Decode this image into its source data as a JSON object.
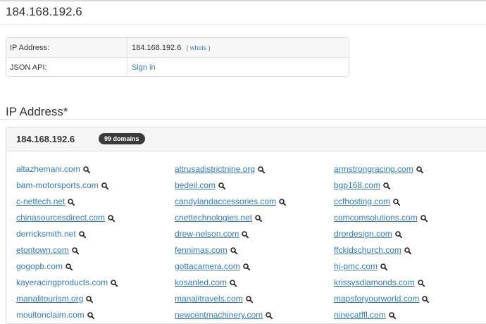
{
  "page": {
    "title": "184.168.192.6"
  },
  "info": {
    "rows": [
      {
        "label": "IP Address:",
        "value": "184.168.192.6",
        "whois_open": "(",
        "whois": "whois",
        "whois_close": ")"
      },
      {
        "label": "JSON API:",
        "link": "Sign in"
      }
    ]
  },
  "section": {
    "title": "IP Address*"
  },
  "panel": {
    "ip": "184.168.192.6",
    "badge": "99 domains"
  },
  "domains": [
    [
      "altazhemani.com",
      "altrusadistrictnine.org",
      "armstrongracing.com"
    ],
    [
      "bam-motorsports.com",
      "bedeil.com",
      "bgp168.com"
    ],
    [
      "c-nettech.net",
      "candylandaccessories.com",
      "ccfhosting.com"
    ],
    [
      "chinasourcesdirect.com",
      "cnettechnologies.net",
      "comcomsolutions.com"
    ],
    [
      "derricksmith.net",
      "drew-nelson.com",
      "drordesign.com"
    ],
    [
      "etontown.com",
      "fennimas.com",
      "ffckidschurch.com"
    ],
    [
      "gogopb.com",
      "gottacamera.com",
      "hj-pmc.com"
    ],
    [
      "kayeracingproducts.com",
      "kosanled.com",
      "krissysdiamonds.com"
    ],
    [
      "manalitourism.org",
      "manalitravels.com",
      "mapsforyourworld.com"
    ],
    [
      "moultonclaim.com",
      "newcentmachinery.com",
      "ninecatffl.com"
    ]
  ],
  "colors": {
    "link": "#337ab7",
    "badge_bg": "#3a3a3a"
  },
  "icons": {
    "domain_search": "magnifier-icon"
  }
}
